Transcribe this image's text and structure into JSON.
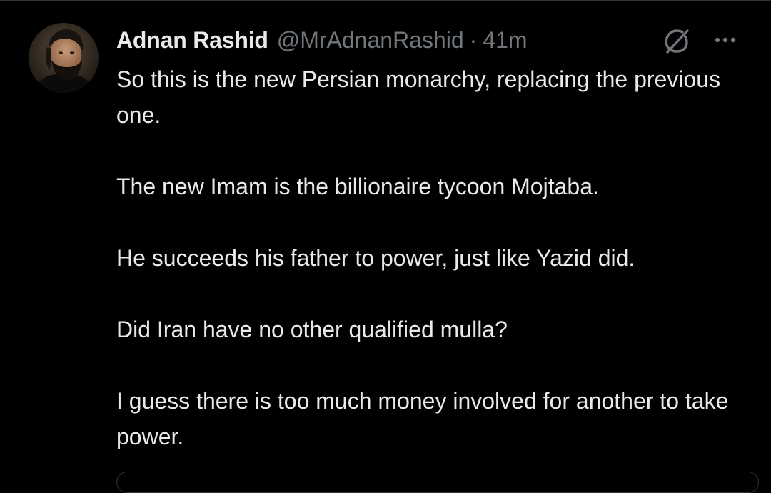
{
  "tweet": {
    "author": {
      "display_name": "Adnan Rashid",
      "handle": "@MrAdnanRashid",
      "separator": "·",
      "time": "41m"
    },
    "icons": {
      "grok": "grok-icon",
      "more": "more-icon"
    },
    "paragraphs": [
      "So this is the new Persian monarchy, replacing the previous one.",
      "The new Imam is the billionaire tycoon Mojtaba.",
      "He succeeds his father to power, just like Yazid did.",
      "Did Iran have no other qualified mulla?",
      "I guess there is too much money involved for another to take power."
    ]
  },
  "colors": {
    "background": "#000000",
    "primary_text": "#e7e9ea",
    "secondary_text": "#71767b",
    "border": "#2f3336"
  }
}
